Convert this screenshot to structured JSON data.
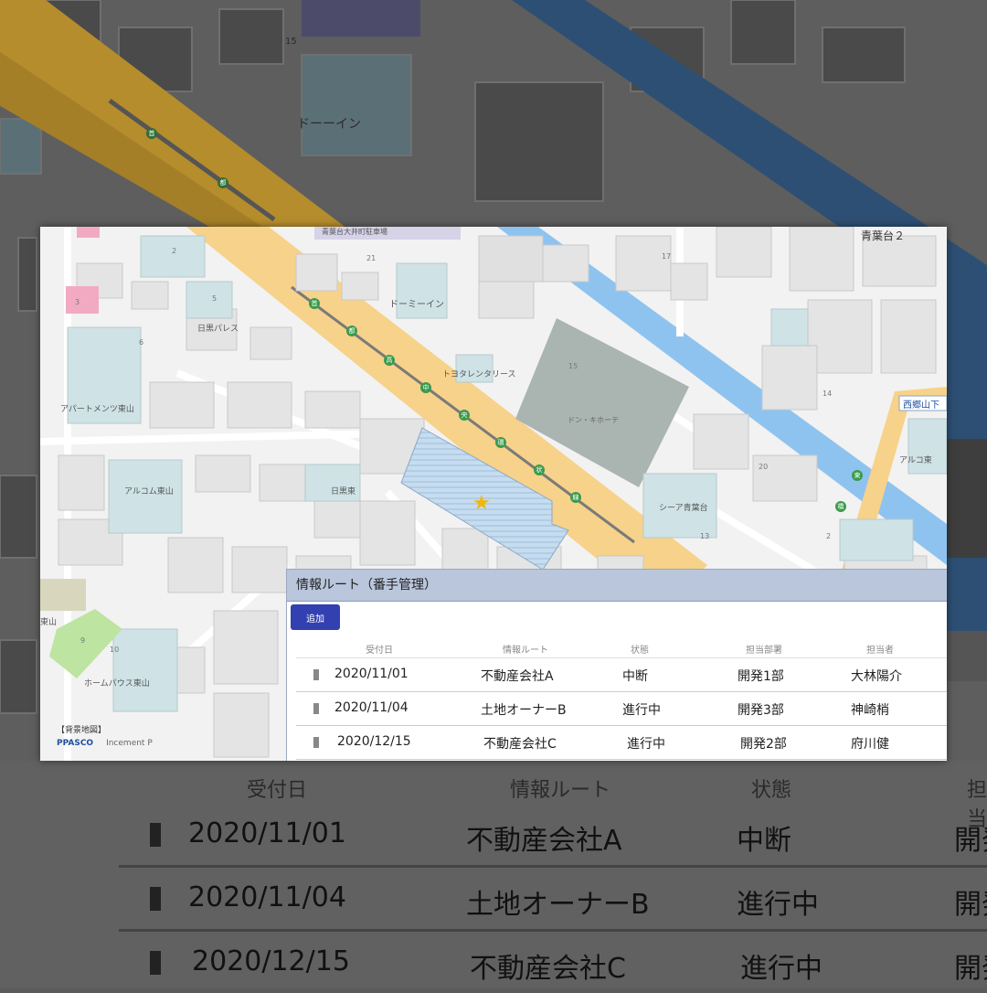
{
  "map": {
    "area_label": "青葉台２",
    "stop_label": "西郷山下",
    "labels": {
      "dormy_inn": "ドーミーイン",
      "toyota_rentalease": "トヨタレンタリース",
      "hibiya_palace": "日黒パレス",
      "apartment_higashiyama": "アパートメンツ東山",
      "alcom_higashiyama": "アルコム東山",
      "homes_higashiyama": "ホームパウス東山",
      "don_quijote": "ドン・キホーテ",
      "sky_aobadai": "シーア青葉台",
      "higashiyama": "東山",
      "alcom_short": "アルコ東",
      "minami_higashi": "日黒東",
      "top_label": "青葉台大井町駐車場"
    },
    "block_numbers": [
      "2",
      "5",
      "3",
      "6",
      "21",
      "17",
      "15",
      "14",
      "20",
      "13",
      "10",
      "9",
      "2"
    ],
    "road_marks": [
      "首",
      "都",
      "高",
      "中",
      "央",
      "環",
      "状",
      "線"
    ],
    "road_side_marks": [
      "東",
      "橋"
    ],
    "attribution": {
      "title": "【背景地図】",
      "provider": "PPASCO",
      "provider2": "Incement P"
    }
  },
  "info_window": {
    "title": "情報ルート（番手管理）",
    "add_button": "追加",
    "columns": [
      "受付日",
      "情報ルート",
      "状態",
      "担当部署",
      "担当者"
    ],
    "rows": [
      {
        "date": "2020/11/01",
        "route": "不動産会社A",
        "status": "中断",
        "dept": "開発1部",
        "person": "大林陽介"
      },
      {
        "date": "2020/11/04",
        "route": "土地オーナーB",
        "status": "進行中",
        "dept": "開発3部",
        "person": "神崎梢"
      },
      {
        "date": "2020/12/15",
        "route": "不動産会社C",
        "status": "進行中",
        "dept": "開発2部",
        "person": "府川健"
      }
    ]
  },
  "background": {
    "labels": {
      "dormy_inn": "ドーーイン",
      "top": "15"
    },
    "columns": [
      "受付日",
      "情報ルート",
      "状態",
      "担当"
    ],
    "rows": [
      {
        "date": "2020/11/01",
        "route": "不動産会社A",
        "status": "中断",
        "dept": "開発"
      },
      {
        "date": "2020/11/04",
        "route": "土地オーナーB",
        "status": "進行中",
        "dept": "開発"
      },
      {
        "date": "2020/12/15",
        "route": "不動産会社C",
        "status": "進行中",
        "dept": "開発"
      }
    ]
  },
  "colors": {
    "expressway": "#f7d28a",
    "river": "#8fc3ef",
    "building": "#e6e6e6",
    "park": "#bde4a0",
    "highlight_block": "#c6dcef",
    "header_bar": "#b9c6dc",
    "add_button": "#3340b0"
  }
}
